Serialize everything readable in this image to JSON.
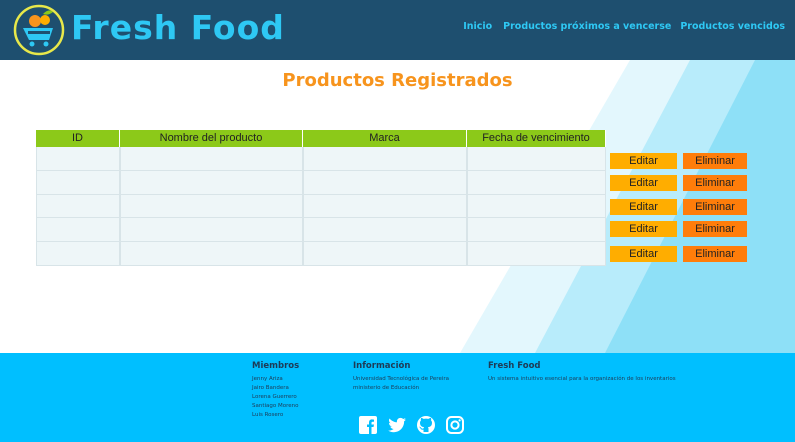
{
  "header": {
    "brand": "Fresh Food",
    "nav": [
      "Inicio",
      "Productos próximos a vencerse",
      "Productos vencidos"
    ]
  },
  "main": {
    "title": "Productos Registrados",
    "table": {
      "columns": [
        "ID",
        "Nombre del producto",
        "Marca",
        "Fecha de vencimiento"
      ],
      "rows": [
        [
          "",
          "",
          "",
          ""
        ],
        [
          "",
          "",
          "",
          ""
        ],
        [
          "",
          "",
          "",
          ""
        ],
        [
          "",
          "",
          "",
          ""
        ],
        [
          "",
          "",
          "",
          ""
        ]
      ]
    },
    "actions": {
      "edit_label": "Editar",
      "delete_label": "Eliminar"
    }
  },
  "footer": {
    "members": {
      "heading": "Miembros",
      "names": [
        "Jenny Ariza",
        "Jairo Bandera",
        "Lorena Guerrero",
        "Santiago Moreno",
        "Luis Rosero"
      ]
    },
    "info": {
      "heading": "Información",
      "lines": [
        "Universidad Tecnológica de Pereira",
        "ministerio de Educación"
      ]
    },
    "brand": {
      "heading": "Fresh Food",
      "description": "Un sistema intuitivo esencial para la organización de los inventarios"
    },
    "social_icons": [
      "facebook-icon",
      "twitter-icon",
      "github-icon",
      "instagram-icon"
    ]
  },
  "colors": {
    "header_bg": "#1e4f6f",
    "brand_text": "#2ec8f4",
    "title": "#f7941d",
    "table_header": "#8cc919",
    "edit_button": "#ffad00",
    "delete_button": "#ff7d0a",
    "footer_bg": "#00bfff"
  }
}
